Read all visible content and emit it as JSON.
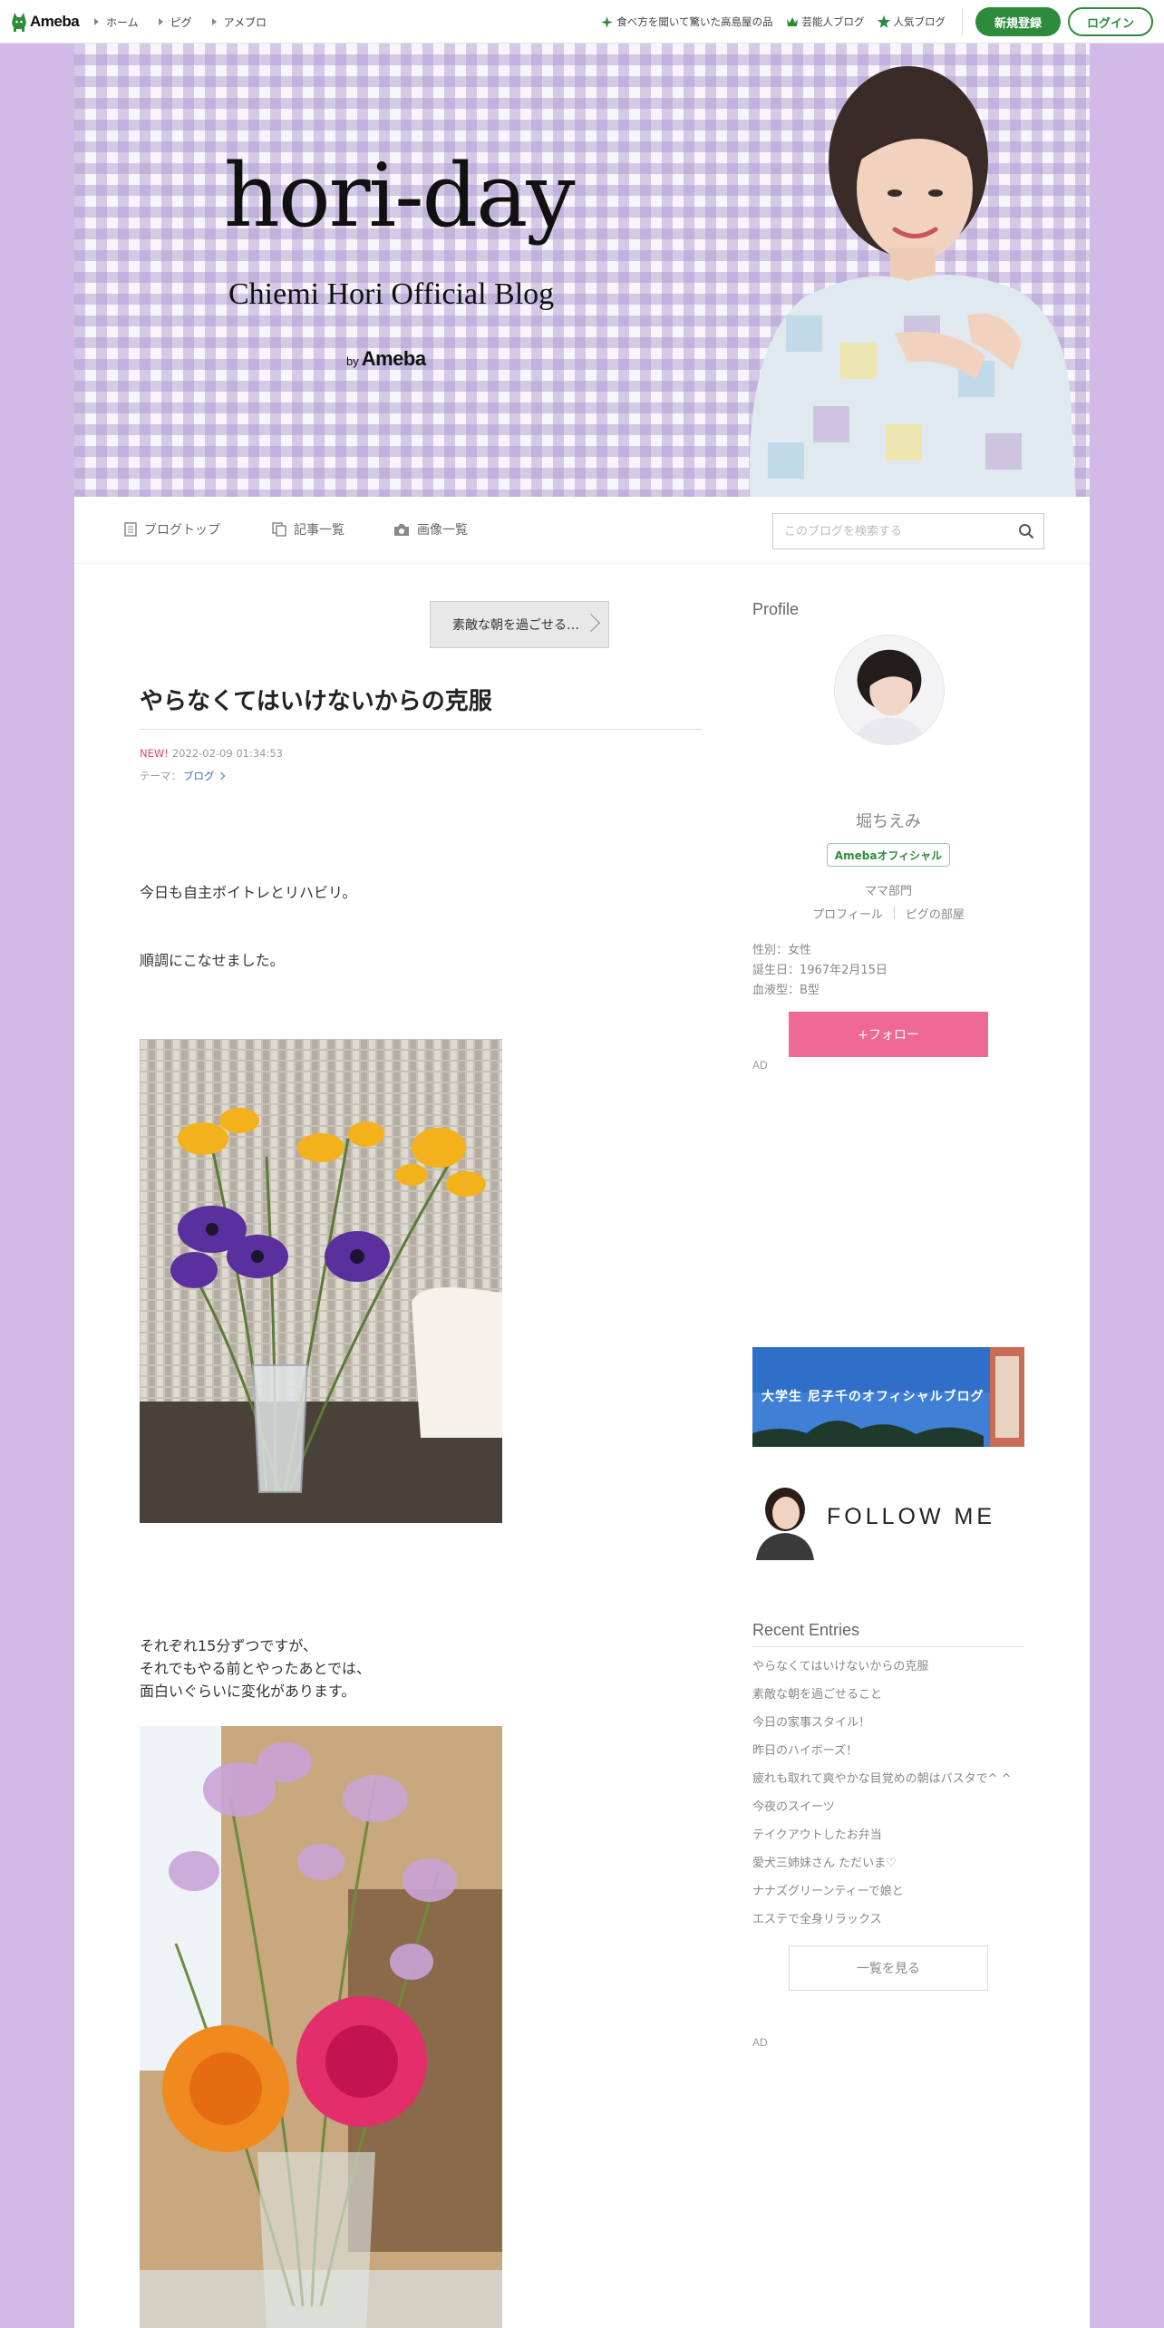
{
  "global_header": {
    "logo_text": "Ameba",
    "nav": [
      {
        "label": "ホーム"
      },
      {
        "label": "ピグ"
      },
      {
        "label": "アメブロ"
      }
    ],
    "links": [
      {
        "label": "食べ方を聞いて驚いた高島屋の品",
        "icon": "leaf-icon"
      },
      {
        "label": "芸能人ブログ",
        "icon": "crown-icon"
      },
      {
        "label": "人気ブログ",
        "icon": "star-icon"
      }
    ],
    "register_label": "新規登録",
    "login_label": "ログイン",
    "brand_color": "#2d8c3c"
  },
  "banner": {
    "title": "hori-day",
    "subtitle": "Chiemi Hori Official Blog",
    "by": "by",
    "brand": "Ameba"
  },
  "blog_nav": {
    "items": [
      {
        "label": "ブログトップ",
        "icon": "document-icon"
      },
      {
        "label": "記事一覧",
        "icon": "pages-icon"
      },
      {
        "label": "画像一覧",
        "icon": "camera-icon"
      }
    ],
    "search_placeholder": "このブログを検索する"
  },
  "article": {
    "prev_label": "素敵な朝を過ごせる…",
    "title": "やらなくてはいけないからの克服",
    "new_badge": "NEW!",
    "datetime": "2022-02-09 01:34:53",
    "theme_prefix": "テーマ：",
    "theme": "ブログ",
    "paragraphs": [
      "今日も自主ボイトレとリハビリ。",
      "順調にこなせました。",
      "それぞれ15分ずつですが、",
      "それでもやる前とやったあとでは、",
      "面白いぐらいに変化があります。"
    ]
  },
  "sidebar": {
    "profile_heading": "Profile",
    "name": "堀ちえみ",
    "official_badge": "Amebaオフィシャル",
    "category": "ママ部門",
    "profile_link": "プロフィール",
    "pig_link": "ピグの部屋",
    "gender": "性別：女性",
    "birthday": "誕生日：1967年2月15日",
    "blood": "血液型：B型",
    "follow_label": "+フォロー",
    "ad_label": "AD",
    "banner1_text": "大学生 尼子千のオフィシャルブログ",
    "banner2_text": "FOLLOW ME",
    "recent_heading": "Recent Entries",
    "recent_entries": [
      "やらなくてはいけないからの克服",
      "素敵な朝を過ごせること",
      "今日の家事スタイル！",
      "昨日のハイボーズ！",
      "疲れも取れて爽やかな目覚めの朝はパスタで^ ^",
      "今夜のスイーツ",
      "テイクアウトしたお弁当",
      "愛犬三姉妹さん ただいま♡",
      "ナナズグリーンティーで娘と",
      "エステで全身リラックス"
    ],
    "more_label": "一覧を見る",
    "follow_color": "#ef6996"
  }
}
